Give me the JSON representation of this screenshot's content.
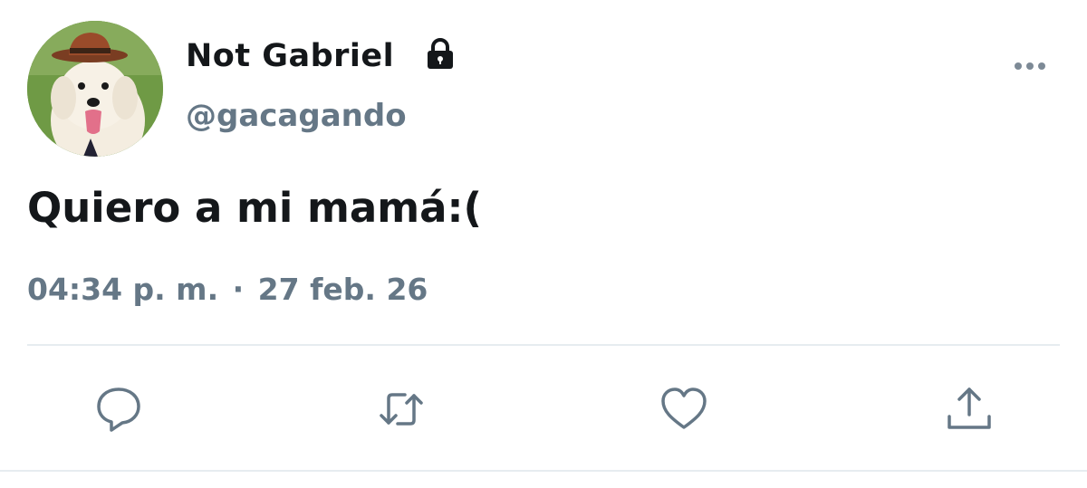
{
  "user": {
    "display_name": "Not Gabriel",
    "handle": "@gacagando",
    "protected_icon": "lock-icon",
    "avatar": "dog-with-hat-avatar"
  },
  "tweet": {
    "text": "Quiero a mi mamá:(",
    "time": "04:34 p. m.",
    "separator": "·",
    "date": "27 feb. 26"
  },
  "actions": {
    "reply_icon": "reply-icon",
    "retweet_icon": "retweet-icon",
    "like_icon": "heart-icon",
    "share_icon": "share-icon",
    "more_icon": "more-icon"
  },
  "colors": {
    "text_primary": "#14171a",
    "text_secondary": "#657786",
    "icon": "#657786",
    "divider": "#e6ecf0"
  }
}
